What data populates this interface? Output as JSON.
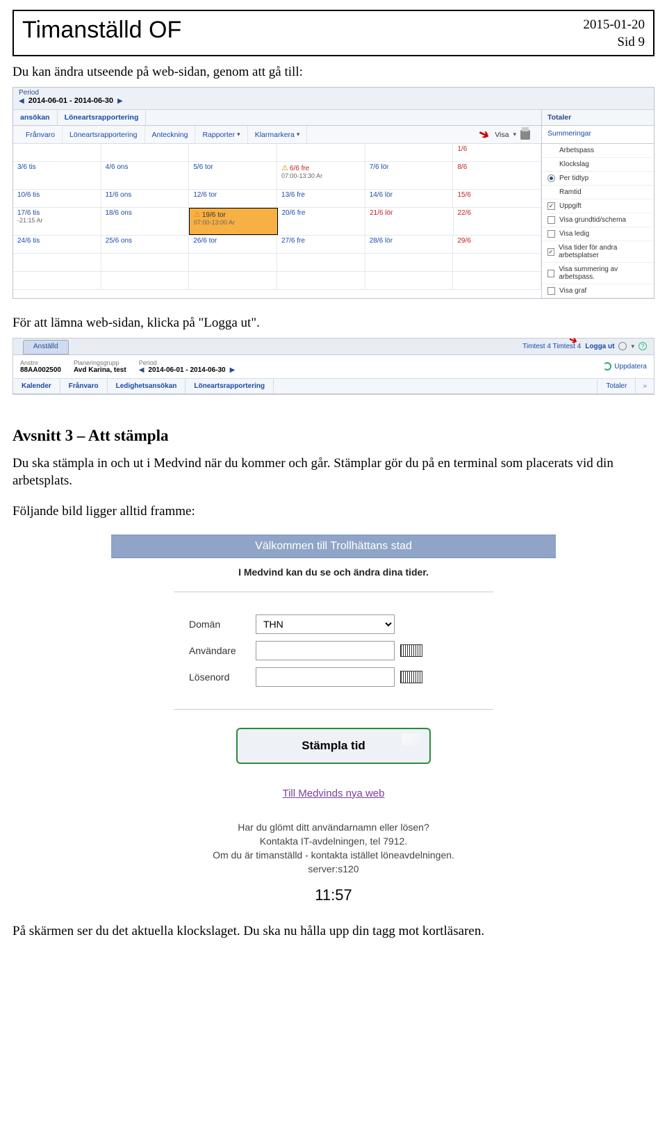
{
  "header": {
    "title": "Timanställd  OF",
    "date": "2015-01-20",
    "page": "Sid 9"
  },
  "text": {
    "intro1": "Du kan ändra utseende på web-sidan, genom att gå till:",
    "intro2": "För att lämna web-sidan, klicka på \"Logga ut\".",
    "section_h": "Avsnitt 3 – Att stämpla",
    "section_p1": "Du ska stämpla in och ut i Medvind när du kommer och går. Stämplar gör du på en terminal som placerats vid din arbetsplats.",
    "section_p2": "Följande bild ligger alltid framme:",
    "outro": "På skärmen ser du det aktuella klockslaget. Du ska nu hålla upp din tagg mot kortläsaren."
  },
  "shot1": {
    "period_label": "Period",
    "period_dates": "2014-06-01 - 2014-06-30",
    "top_tabs": [
      "ansökan",
      "Löneartsrapportering"
    ],
    "toolbar": [
      "Frånvaro",
      "Löneartsrapportering",
      "Anteckning",
      "Rapporter",
      "Klarmarkera"
    ],
    "visa_label": "Visa",
    "side_head": "Totaler",
    "side_sub": "Summeringar",
    "side_items": [
      {
        "type": "plain",
        "label": "Arbetspass"
      },
      {
        "type": "plain",
        "label": "Klockslag"
      },
      {
        "type": "radio",
        "on": true,
        "label": "Per tidtyp"
      },
      {
        "type": "plain",
        "label": "Ramtid"
      },
      {
        "type": "check",
        "on": true,
        "label": "Uppgift"
      },
      {
        "type": "check",
        "on": false,
        "label": "Visa grundtid/schema"
      },
      {
        "type": "check",
        "on": false,
        "label": "Visa ledig"
      },
      {
        "type": "check",
        "on": true,
        "label": "Visa tider för andra arbetsplatser"
      },
      {
        "type": "check",
        "on": false,
        "label": "Visa summering av arbetspass."
      },
      {
        "type": "check",
        "on": false,
        "label": "Visa graf"
      }
    ],
    "rows": [
      {
        "cells": [
          {
            "t": ""
          },
          {
            "t": ""
          },
          {
            "t": ""
          },
          {
            "t": ""
          },
          {
            "t": ""
          },
          {
            "t": "1/6",
            "red": true
          }
        ],
        "h": "short"
      },
      {
        "cells": [
          {
            "t": "3/6 tis"
          },
          {
            "t": "4/6 ons"
          },
          {
            "t": "5/6 tor"
          },
          {
            "t": "6/6 fre",
            "red": true,
            "warn": true,
            "sub": "07:00-13:30  Ar"
          },
          {
            "t": "7/6 lör"
          },
          {
            "t": "8/6",
            "red": true
          }
        ],
        "h": "tall"
      },
      {
        "cells": [
          {
            "t": "10/6 tis"
          },
          {
            "t": "11/6 ons"
          },
          {
            "t": "12/6 tor"
          },
          {
            "t": "13/6 fre"
          },
          {
            "t": "14/6 lör"
          },
          {
            "t": "15/6",
            "red": true
          }
        ]
      },
      {
        "cells": [
          {
            "t": "17/6 tis",
            "sub": "-21:15  Ar"
          },
          {
            "t": "18/6 ons"
          },
          {
            "t": "19/6 tor",
            "warn": true,
            "orange": true,
            "sub": "07:00-13:00  Ar"
          },
          {
            "t": "20/6 fre",
            "colblue": true
          },
          {
            "t": "21/6 lör",
            "red": true
          },
          {
            "t": "22/6",
            "red": true
          }
        ],
        "h": "tall"
      },
      {
        "cells": [
          {
            "t": "24/6 tis"
          },
          {
            "t": "25/6 ons"
          },
          {
            "t": "26/6 tor"
          },
          {
            "t": "27/6 fre"
          },
          {
            "t": "28/6 lör"
          },
          {
            "t": "29/6",
            "red": true
          }
        ]
      },
      {
        "cells": [
          {
            "t": ""
          },
          {
            "t": ""
          },
          {
            "t": ""
          },
          {
            "t": ""
          },
          {
            "t": ""
          },
          {
            "t": ""
          }
        ]
      },
      {
        "cells": [
          {
            "t": ""
          },
          {
            "t": ""
          },
          {
            "t": ""
          },
          {
            "t": ""
          },
          {
            "t": ""
          },
          {
            "t": ""
          }
        ]
      }
    ]
  },
  "shot2": {
    "tab": "Anställd",
    "user": "Timtest 4 Timtest 4",
    "logout": "Logga ut",
    "anstnr_h": "Anstnr",
    "anstnr_v": "88AA002500",
    "plan_h": "Planeringsgrupp",
    "plan_v": "Avd Karina, test",
    "period_h": "Period",
    "period_v": "2014-06-01 - 2014-06-30",
    "uppdatera": "Uppdatera",
    "tabs3": [
      "Kalender",
      "Frånvaro",
      "Ledighetsansökan",
      "Löneartsrapportering"
    ],
    "totaler": "Totaler",
    "chev": "»"
  },
  "shot3": {
    "banner": "Välkommen till Trollhättans stad",
    "intro": "I Medvind kan du se och ändra dina tider.",
    "domain_l": "Domän",
    "domain_v": "THN",
    "user_l": "Användare",
    "pass_l": "Lösenord",
    "stamp": "Stämpla tid",
    "link": "Till Medvinds nya web",
    "help1": "Har du glömt ditt användarnamn eller lösen?",
    "help2": "Kontakta IT-avdelningen, tel 7912.",
    "help3": "Om du är timanställd - kontakta istället löneavdelningen.",
    "help4": "server:s120",
    "clock": "11:57"
  }
}
